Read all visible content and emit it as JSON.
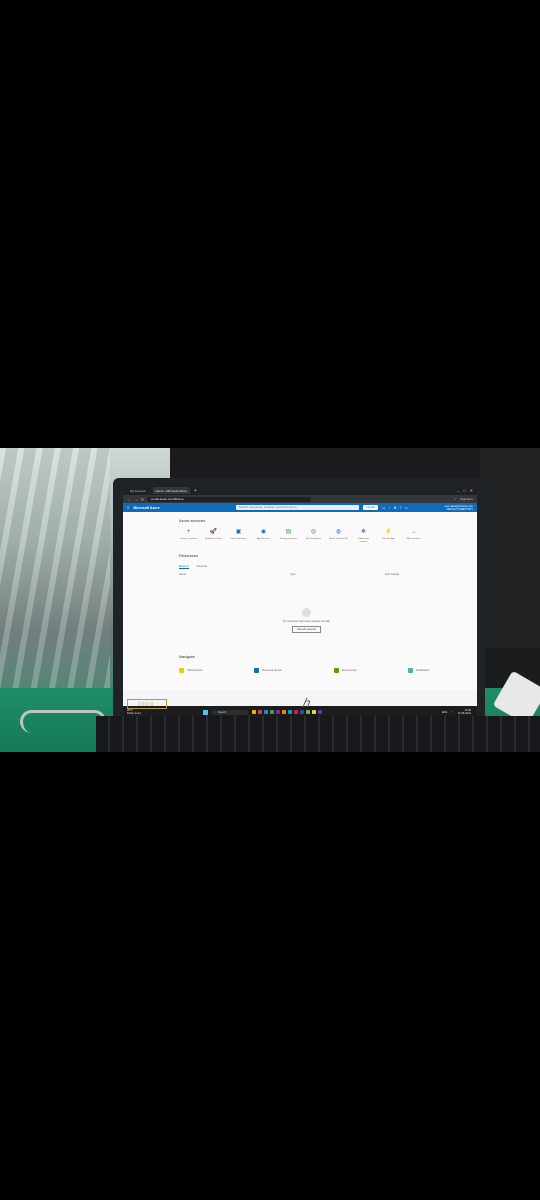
{
  "browser": {
    "tabs": [
      {
        "label": "My Account"
      },
      {
        "label": "Home - Microsoft Azure"
      }
    ],
    "new_tab": "+",
    "url": "portal.azure.com/#home",
    "profile": "Signature"
  },
  "azure_header": {
    "menu_icon": "≡",
    "brand": "Microsoft Azure",
    "search_placeholder": "Search resources, services, and docs (G+/)",
    "copilot": "Copilot",
    "account_line1": "user.name@contoso.com",
    "account_line2": "DEFAULT DIRECTORY"
  },
  "azure_services": {
    "title": "Azure services",
    "items": [
      {
        "label": "Create a resource",
        "icon": "plus-icon",
        "glyph": "+",
        "color": "#0f6cbd"
      },
      {
        "label": "Quickstart Center",
        "icon": "rocket-icon",
        "glyph": "🚀",
        "color": "#e8590c"
      },
      {
        "label": "Virtual machines",
        "icon": "monitor-icon",
        "glyph": "▣",
        "color": "#0078d4"
      },
      {
        "label": "App Services",
        "icon": "globe-icon",
        "glyph": "◉",
        "color": "#0a6fc2"
      },
      {
        "label": "Storage accounts",
        "icon": "storage-icon",
        "glyph": "▤",
        "color": "#3fa845"
      },
      {
        "label": "SQL databases",
        "icon": "sql-icon",
        "glyph": "◎",
        "color": "#0f6cbd"
      },
      {
        "label": "Azure Cosmos DB",
        "icon": "cosmos-icon",
        "glyph": "◍",
        "color": "#2a7ad6"
      },
      {
        "label": "Kubernetes services",
        "icon": "kubernetes-icon",
        "glyph": "❖",
        "color": "#7a4fd3"
      },
      {
        "label": "Function App",
        "icon": "function-icon",
        "glyph": "⚡",
        "color": "#f2a900"
      },
      {
        "label": "More services",
        "icon": "arrow-right-icon",
        "glyph": "→",
        "color": "#0f6cbd"
      }
    ]
  },
  "resources": {
    "title": "Resources",
    "tabs": [
      "Recent",
      "Favorite"
    ],
    "columns": [
      "Name",
      "Type",
      "Last Viewed"
    ],
    "empty_text": "No resources have been viewed recently",
    "empty_button": "View all resources"
  },
  "navigate": {
    "title": "Navigate",
    "items": [
      {
        "label": "Subscriptions",
        "icon": "key-icon",
        "color": "#f2c811"
      },
      {
        "label": "Resource groups",
        "icon": "resource-group-icon",
        "color": "#0f6cbd"
      },
      {
        "label": "All resources",
        "icon": "grid-icon",
        "color": "#57a300"
      },
      {
        "label": "Dashboard",
        "icon": "dashboard-icon",
        "color": "#4db6ac"
      }
    ]
  },
  "taskbar": {
    "weather_line1": "28°C",
    "weather_line2": "Partly sunny",
    "search": "Search",
    "language": "ENG",
    "time": "10:42",
    "date": "22-08-2024",
    "app_colors": [
      "#f4b400",
      "#e53935",
      "#1e88e5",
      "#43a047",
      "#8e24aa",
      "#fb8c00",
      "#00acc1",
      "#d81b60",
      "#3949ab",
      "#7cb342",
      "#fdd835",
      "#5e35b1"
    ]
  },
  "laptop": {
    "sticker": "Ghibli"
  }
}
